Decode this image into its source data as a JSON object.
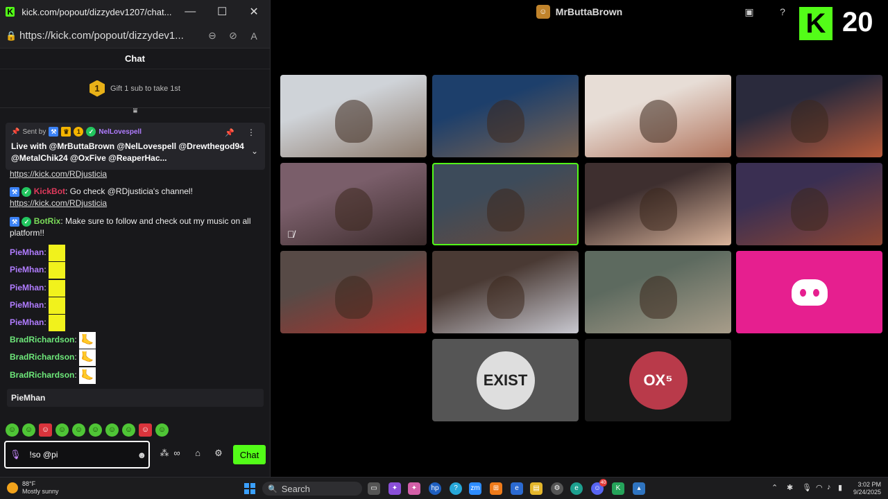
{
  "window": {
    "title": "kick.com/popout/dizzydev1207/chat...",
    "controls": {
      "minimize": "—",
      "maximize": "☐",
      "close": "✕"
    }
  },
  "address_bar": {
    "url": "https://kick.com/popout/dizzydev1...",
    "lock_icon": "🔒"
  },
  "chat": {
    "header": "Chat",
    "gift": {
      "rank": "1",
      "text": "Gift 1 sub to take 1st"
    },
    "pinned": {
      "sent_by": "Sent by",
      "username": "NelLovespell",
      "coin": "1",
      "text": "Live with @MrButtaBrown @NelLovespell @Drewthegod94 @MetalChik24 @OxFive @ReaperHac..."
    },
    "messages": [
      {
        "type": "link",
        "link": "https://kick.com/RDjusticia"
      },
      {
        "type": "bot",
        "user": "KickBot",
        "color": "#e03a5c",
        "text": "Go check @RDjusticia's channel!",
        "link": "https://kick.com/RDjusticia"
      },
      {
        "type": "bot",
        "user": "BotRix",
        "color": "#7bdc5a",
        "text": "Make sure to follow and check out my music on all platform!!"
      },
      {
        "type": "emote",
        "user": "PieMhan",
        "color": "#b07cff",
        "emote": "yellow"
      },
      {
        "type": "emote",
        "user": "PieMhan",
        "color": "#b07cff",
        "emote": "yellow"
      },
      {
        "type": "emote",
        "user": "PieMhan",
        "color": "#b07cff",
        "emote": "yellow"
      },
      {
        "type": "emote",
        "user": "PieMhan",
        "color": "#b07cff",
        "emote": "yellow"
      },
      {
        "type": "emote",
        "user": "PieMhan",
        "color": "#b07cff",
        "emote": "yellow"
      },
      {
        "type": "emote",
        "user": "BradRichardson",
        "color": "#6ee87a",
        "emote": "foot"
      },
      {
        "type": "emote",
        "user": "BradRichardson",
        "color": "#6ee87a",
        "emote": "foot"
      },
      {
        "type": "emote",
        "user": "BradRichardson",
        "color": "#6ee87a",
        "emote": "foot"
      }
    ],
    "reply_to": "PieMhan",
    "input": {
      "value": "!so @pi"
    },
    "send_label": "Chat",
    "emote_bar": [
      "green",
      "green",
      "red",
      "green",
      "green",
      "green",
      "green",
      "green",
      "red",
      "green"
    ]
  },
  "stream": {
    "host": "MrButtaBrown",
    "badge_number": "20",
    "tiles": [
      {
        "kind": "cam",
        "colors": [
          "#cfd3d8",
          "#8c7a6c"
        ]
      },
      {
        "kind": "cam",
        "colors": [
          "#1d3f6b",
          "#7d6450"
        ]
      },
      {
        "kind": "cam",
        "colors": [
          "#e7ddd6",
          "#b0725a"
        ]
      },
      {
        "kind": "cam",
        "colors": [
          "#2a2a3c",
          "#b65a3a"
        ]
      },
      {
        "kind": "cam",
        "colors": [
          "#7a5e6a",
          "#3b2b2b"
        ],
        "muted": true
      },
      {
        "kind": "cam",
        "colors": [
          "#3d4b5a",
          "#6b4a3a"
        ],
        "active": true
      },
      {
        "kind": "cam",
        "colors": [
          "#3e2f2f",
          "#d9b39a"
        ]
      },
      {
        "kind": "cam",
        "colors": [
          "#3a2f52",
          "#8e4633"
        ]
      },
      {
        "kind": "cam",
        "colors": [
          "#574a46",
          "#a8322c"
        ]
      },
      {
        "kind": "cam",
        "colors": [
          "#4a3a34",
          "#c8c8d0"
        ]
      },
      {
        "kind": "cam",
        "colors": [
          "#5d6a5f",
          "#a89d8a"
        ]
      },
      {
        "kind": "discord"
      },
      {
        "kind": "avatar",
        "text": "EXIST",
        "bg": "#555",
        "circle": "#dedede",
        "fg": "#222"
      },
      {
        "kind": "avatar",
        "text": "OX⁵",
        "bg": "#1a1a1a",
        "circle": "#b93a4a",
        "fg": "#fff"
      }
    ]
  },
  "taskbar": {
    "weather": {
      "temp": "88°F",
      "desc": "Mostly sunny"
    },
    "search_placeholder": "Search",
    "time": "3:02 PM",
    "date": "9/24/2025",
    "discord_badge": "40"
  }
}
